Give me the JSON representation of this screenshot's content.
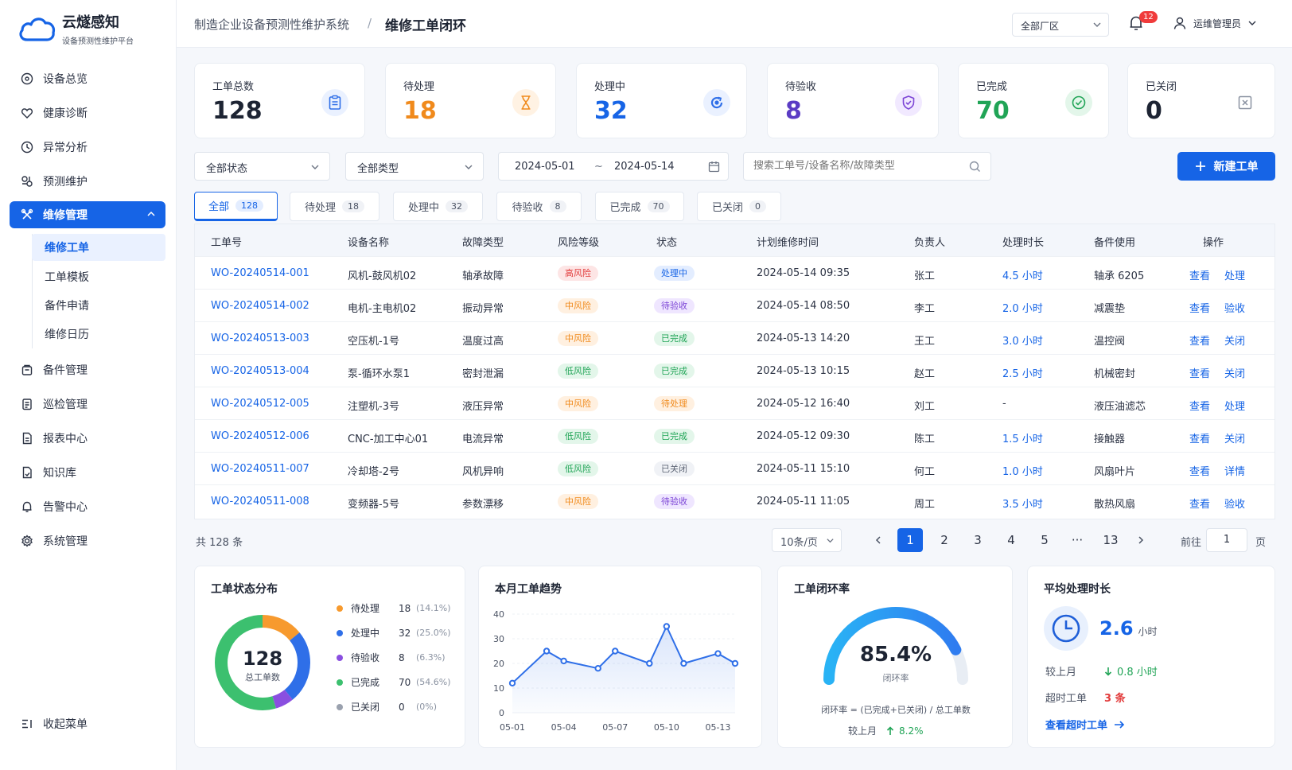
{
  "app": {
    "name": "云燧感知",
    "subtitle": "设备预测性维护平台"
  },
  "sidebar": {
    "items": [
      {
        "label": "设备总览",
        "icon": "dashboard-icon"
      },
      {
        "label": "健康诊断",
        "icon": "heart-icon"
      },
      {
        "label": "异常分析",
        "icon": "chart-icon"
      },
      {
        "label": "预测维护",
        "icon": "predict-icon"
      },
      {
        "label": "维修管理",
        "icon": "wrench-icon"
      },
      {
        "label": "备件管理",
        "icon": "box-icon"
      },
      {
        "label": "巡检管理",
        "icon": "clipboard-icon"
      },
      {
        "label": "报表中心",
        "icon": "report-icon"
      },
      {
        "label": "知识库",
        "icon": "book-icon"
      },
      {
        "label": "告警中心",
        "icon": "bell-icon"
      },
      {
        "label": "系统管理",
        "icon": "gear-icon"
      }
    ],
    "sub_items": [
      "维修工单",
      "工单模板",
      "备件申请",
      "维修日历"
    ],
    "collapse_label": "收起菜单"
  },
  "header": {
    "breadcrumb_root": "制造企业设备预测性维护系统",
    "breadcrumb_sep": "/",
    "breadcrumb_current": "维修工单闭环",
    "factory_select": "全部厂区",
    "notification_count": "12",
    "user_name": "运维管理员"
  },
  "stats": [
    {
      "label": "工单总数",
      "value": "128",
      "color": "#1d2433",
      "icon": "clipboard-icon"
    },
    {
      "label": "待处理",
      "value": "18",
      "color": "#f08a1c",
      "icon": "hourglass-icon"
    },
    {
      "label": "处理中",
      "value": "32",
      "color": "#1664e6",
      "icon": "refresh-icon"
    },
    {
      "label": "待验收",
      "value": "8",
      "color": "#5b3cc4",
      "icon": "shield-icon"
    },
    {
      "label": "已完成",
      "value": "70",
      "color": "#20a456",
      "icon": "check-circle-icon"
    },
    {
      "label": "已关闭",
      "value": "0",
      "color": "#1d2433",
      "icon": "close-box-icon"
    }
  ],
  "filters": {
    "status": "全部状态",
    "type": "全部类型",
    "date_start": "2024-05-01",
    "date_sep": "~",
    "date_end": "2024-05-14",
    "search_placeholder": "搜索工单号/设备名称/故障类型",
    "new_button": "新建工单"
  },
  "tabs": [
    {
      "label": "全部",
      "count": "128"
    },
    {
      "label": "待处理",
      "count": "18"
    },
    {
      "label": "处理中",
      "count": "32"
    },
    {
      "label": "待验收",
      "count": "8"
    },
    {
      "label": "已完成",
      "count": "70"
    },
    {
      "label": "已关闭",
      "count": "0"
    }
  ],
  "table": {
    "headers": [
      "工单号",
      "设备名称",
      "故障类型",
      "风险等级",
      "状态",
      "计划维修时间",
      "负责人",
      "处理时长",
      "备件使用",
      "操作"
    ],
    "rows": [
      {
        "id": "WO-20240514-001",
        "device": "风机-鼓风机02",
        "fault": "轴承故障",
        "risk": "高风险",
        "risk_class": "risk-high",
        "status": "处理中",
        "status_class": "st-proc",
        "time": "2024-05-14 09:35",
        "owner": "张工",
        "duration": "4.5 小时",
        "part": "轴承 6205",
        "op1": "查看",
        "op2": "处理"
      },
      {
        "id": "WO-20240514-002",
        "device": "电机-主电机02",
        "fault": "振动异常",
        "risk": "中风险",
        "risk_class": "risk-mid",
        "status": "待验收",
        "status_class": "st-acc",
        "time": "2024-05-14 08:50",
        "owner": "李工",
        "duration": "2.0 小时",
        "part": "减震垫",
        "op1": "查看",
        "op2": "验收"
      },
      {
        "id": "WO-20240513-003",
        "device": "空压机-1号",
        "fault": "温度过高",
        "risk": "中风险",
        "risk_class": "risk-mid",
        "status": "已完成",
        "status_class": "st-done",
        "time": "2024-05-13 14:20",
        "owner": "王工",
        "duration": "3.0 小时",
        "part": "温控阀",
        "op1": "查看",
        "op2": "关闭"
      },
      {
        "id": "WO-20240513-004",
        "device": "泵-循环水泵1",
        "fault": "密封泄漏",
        "risk": "低风险",
        "risk_class": "risk-low",
        "status": "已完成",
        "status_class": "st-done",
        "time": "2024-05-13 10:15",
        "owner": "赵工",
        "duration": "2.5 小时",
        "part": "机械密封",
        "op1": "查看",
        "op2": "关闭"
      },
      {
        "id": "WO-20240512-005",
        "device": "注塑机-3号",
        "fault": "液压异常",
        "risk": "中风险",
        "risk_class": "risk-mid",
        "status": "待处理",
        "status_class": "st-pend",
        "time": "2024-05-12 16:40",
        "owner": "刘工",
        "duration": "-",
        "part": "液压油滤芯",
        "op1": "查看",
        "op2": "处理"
      },
      {
        "id": "WO-20240512-006",
        "device": "CNC-加工中心01",
        "fault": "电流异常",
        "risk": "低风险",
        "risk_class": "risk-low",
        "status": "已完成",
        "status_class": "st-done",
        "time": "2024-05-12 09:30",
        "owner": "陈工",
        "duration": "1.5 小时",
        "part": "接触器",
        "op1": "查看",
        "op2": "关闭"
      },
      {
        "id": "WO-20240511-007",
        "device": "冷却塔-2号",
        "fault": "风机异响",
        "risk": "低风险",
        "risk_class": "risk-low",
        "status": "已关闭",
        "status_class": "st-closed",
        "time": "2024-05-11 15:10",
        "owner": "何工",
        "duration": "1.0 小时",
        "part": "风扇叶片",
        "op1": "查看",
        "op2": "详情"
      },
      {
        "id": "WO-20240511-008",
        "device": "变频器-5号",
        "fault": "参数漂移",
        "risk": "中风险",
        "risk_class": "risk-mid",
        "status": "待验收",
        "status_class": "st-acc",
        "time": "2024-05-11 11:05",
        "owner": "周工",
        "duration": "3.5 小时",
        "part": "散热风扇",
        "op1": "查看",
        "op2": "验收"
      }
    ]
  },
  "pagination": {
    "total": "共 128 条",
    "page_size": "10条/页",
    "pages": [
      "1",
      "2",
      "3",
      "4",
      "5",
      "···",
      "13"
    ],
    "goto_label": "前往",
    "goto_value": "1",
    "page_unit": "页"
  },
  "status_panel": {
    "title": "工单状态分布",
    "center_value": "128",
    "center_label": "总工单数",
    "items": [
      {
        "label": "待处理",
        "value": "18",
        "pct": "(14.1%)",
        "color": "#f79a2e",
        "share": 0.141
      },
      {
        "label": "处理中",
        "value": "32",
        "pct": "(25.0%)",
        "color": "#2f6fe8",
        "share": 0.25
      },
      {
        "label": "待验收",
        "value": "8",
        "pct": "(6.3%)",
        "color": "#8a4fe0",
        "share": 0.063
      },
      {
        "label": "已完成",
        "value": "70",
        "pct": "(54.6%)",
        "color": "#3cc06f",
        "share": 0.546
      },
      {
        "label": "已关闭",
        "value": "0",
        "pct": "(0%)",
        "color": "#9aa1ae",
        "share": 0
      }
    ]
  },
  "chart_data": {
    "type": "area",
    "title": "本月工单趋势",
    "x": [
      "05-01",
      "05-02",
      "05-03",
      "05-04",
      "05-05",
      "05-06",
      "05-07",
      "05-08",
      "05-09",
      "05-10",
      "05-11",
      "05-12",
      "05-13",
      "05-14"
    ],
    "x_tick_labels": [
      "05-01",
      "05-04",
      "05-07",
      "05-10",
      "05-13"
    ],
    "values": [
      12,
      25,
      21,
      18,
      25,
      20,
      35,
      20,
      24,
      20
    ],
    "value_x_index": [
      0,
      2,
      3,
      5,
      6,
      8,
      9,
      10,
      12,
      13
    ],
    "ylim": [
      0,
      40
    ],
    "y_ticks": [
      0,
      10,
      20,
      30,
      40
    ],
    "grid": true,
    "color": "#2f6fe8"
  },
  "closure_panel": {
    "title": "工单闭环率",
    "value": "85.4%",
    "value_num": 85.4,
    "label": "闭环率",
    "formula": "闭环率 = (已完成+已关闭) / 总工单数",
    "compare_label": "较上月",
    "compare_value": "8.2%"
  },
  "avg_panel": {
    "title": "平均处理时长",
    "value": "2.6",
    "unit": "小时",
    "compare_label": "较上月",
    "compare_value": "0.8 小时",
    "overtime_label": "超时工单",
    "overtime_value": "3 条",
    "link_label": "查看超时工单"
  }
}
